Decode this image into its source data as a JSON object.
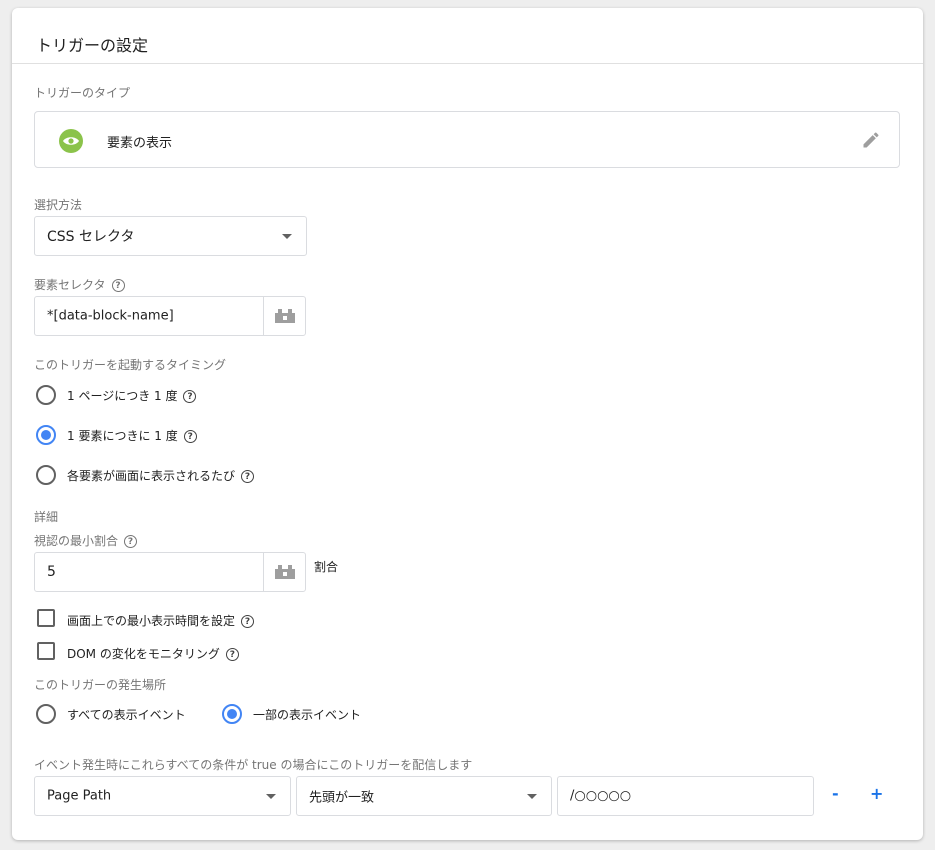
{
  "title": "トリガーの設定",
  "trigger_type": {
    "label": "トリガーのタイプ",
    "value": "要素の表示",
    "icon": "eye-icon",
    "icon_color": "#8bc34a"
  },
  "selection_method": {
    "label": "選択方法",
    "value": "CSS セレクタ"
  },
  "element_selector": {
    "label": "要素セレクタ",
    "value": "*[data-block-name]"
  },
  "timing": {
    "label": "このトリガーを起動するタイミング",
    "options": [
      {
        "label": "1 ページにつき 1 度",
        "selected": false
      },
      {
        "label": "1 要素につきに 1 度",
        "selected": true
      },
      {
        "label": "各要素が画面に表示されるたび",
        "selected": false
      }
    ]
  },
  "details": {
    "heading": "詳細",
    "min_visible_label": "視認の最小割合",
    "min_visible_value": "5",
    "unit": "割合",
    "checkbox_min_time": "画面上での最小表示時間を設定",
    "checkbox_dom": "DOM の変化をモニタリング"
  },
  "fires_on": {
    "label": "このトリガーの発生場所",
    "all": "すべての表示イベント",
    "some": "一部の表示イベント",
    "selected": "some"
  },
  "condition": {
    "label": "イベント発生時にこれらすべての条件が true の場合にこのトリガーを配信します",
    "variable": "Page Path",
    "operator": "先頭が一致",
    "value": "/○○○○○",
    "minus": "-",
    "plus": "+"
  },
  "colors": {
    "accent": "#4285f4",
    "link": "#1a73e8"
  }
}
